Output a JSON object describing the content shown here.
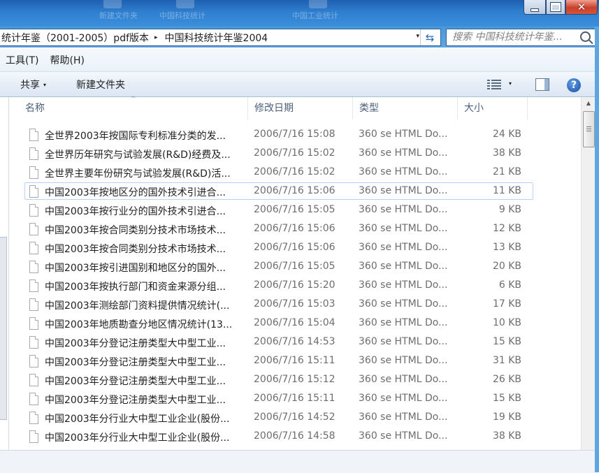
{
  "desktop_ghosts": [
    "新建文件夹",
    "中国科技统计",
    "中国工业统计"
  ],
  "window_controls": {
    "close_glyph": "✕"
  },
  "address": {
    "crumbs": [
      "统计年鉴（2001-2005）pdf版本",
      "中国科技统计年鉴2004"
    ],
    "separator": "▸",
    "dropdown": "▾",
    "refresh_glyph": "⇆"
  },
  "search": {
    "placeholder": "搜索 中国科技统计年鉴..."
  },
  "menu": {
    "tools": "工具(T)",
    "help": "帮助(H)"
  },
  "toolbar": {
    "share": "共享",
    "new_folder": "新建文件夹",
    "caret": "▾",
    "help_glyph": "?"
  },
  "columns": {
    "name": "名称",
    "date": "修改日期",
    "type": "类型",
    "size": "大小",
    "sort_glyph": "^"
  },
  "files": [
    {
      "name": "全世界2003年按国际专利标准分类的发...",
      "date": "2006/7/16 15:08",
      "type": "360 se HTML Do...",
      "size": "24 KB"
    },
    {
      "name": "全世界历年研究与试验发展(R&D)经费及...",
      "date": "2006/7/16 15:02",
      "type": "360 se HTML Do...",
      "size": "38 KB"
    },
    {
      "name": "全世界主要年份研究与试验发展(R&D)活...",
      "date": "2006/7/16 15:02",
      "type": "360 se HTML Do...",
      "size": "21 KB"
    },
    {
      "name": "中国2003年按地区分的国外技术引进合...",
      "date": "2006/7/16 15:06",
      "type": "360 se HTML Do...",
      "size": "11 KB"
    },
    {
      "name": "中国2003年按行业分的国外技术引进合...",
      "date": "2006/7/16 15:05",
      "type": "360 se HTML Do...",
      "size": "9 KB"
    },
    {
      "name": "中国2003年按合同类别分技术市场技术...",
      "date": "2006/7/16 15:06",
      "type": "360 se HTML Do...",
      "size": "12 KB"
    },
    {
      "name": "中国2003年按合同类别分技术市场技术...",
      "date": "2006/7/16 15:06",
      "type": "360 se HTML Do...",
      "size": "13 KB"
    },
    {
      "name": "中国2003年按引进国别和地区分的国外...",
      "date": "2006/7/16 15:05",
      "type": "360 se HTML Do...",
      "size": "20 KB"
    },
    {
      "name": "中国2003年按执行部门和资金来源分组...",
      "date": "2006/7/16 15:20",
      "type": "360 se HTML Do...",
      "size": "6 KB"
    },
    {
      "name": "中国2003年测绘部门资料提供情况统计(...",
      "date": "2006/7/16 15:03",
      "type": "360 se HTML Do...",
      "size": "17 KB"
    },
    {
      "name": "中国2003年地质勘查分地区情况统计(13...",
      "date": "2006/7/16 15:04",
      "type": "360 se HTML Do...",
      "size": "10 KB"
    },
    {
      "name": "中国2003年分登记注册类型大中型工业...",
      "date": "2006/7/16 14:53",
      "type": "360 se HTML Do...",
      "size": "15 KB"
    },
    {
      "name": "中国2003年分登记注册类型大中型工业...",
      "date": "2006/7/16 15:11",
      "type": "360 se HTML Do...",
      "size": "31 KB"
    },
    {
      "name": "中国2003年分登记注册类型大中型工业...",
      "date": "2006/7/16 15:12",
      "type": "360 se HTML Do...",
      "size": "26 KB"
    },
    {
      "name": "中国2003年分登记注册类型大中型工业...",
      "date": "2006/7/16 15:11",
      "type": "360 se HTML Do...",
      "size": "15 KB"
    },
    {
      "name": "中国2003年分行业大中型工业企业(股份...",
      "date": "2006/7/16 14:52",
      "type": "360 se HTML Do...",
      "size": "19 KB"
    },
    {
      "name": "中国2003年分行业大中型工业企业(股份...",
      "date": "2006/7/16 14:58",
      "type": "360 se HTML Do...",
      "size": "38 KB"
    }
  ],
  "hovered_row_index": 3,
  "scrollbar": {
    "up_glyph": "▲"
  }
}
